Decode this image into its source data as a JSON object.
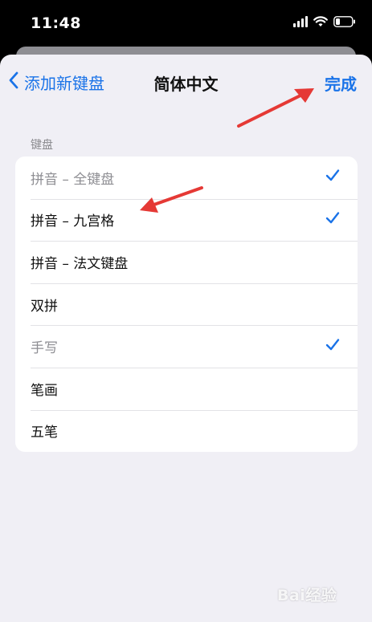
{
  "status_bar": {
    "time": "11:48"
  },
  "nav": {
    "back_label": "添加新键盘",
    "title": "简体中文",
    "done_label": "完成"
  },
  "section": {
    "header": "键盘"
  },
  "keyboards": [
    {
      "label": "拼音 – 全键盘",
      "checked": true,
      "dimmed": true
    },
    {
      "label": "拼音 – 九宫格",
      "checked": true,
      "dimmed": false
    },
    {
      "label": "拼音 – 法文键盘",
      "checked": false,
      "dimmed": false
    },
    {
      "label": "双拼",
      "checked": false,
      "dimmed": false
    },
    {
      "label": "手写",
      "checked": true,
      "dimmed": true
    },
    {
      "label": "笔画",
      "checked": false,
      "dimmed": false
    },
    {
      "label": "五笔",
      "checked": false,
      "dimmed": false
    }
  ],
  "icons": {
    "back": "chevron-left-icon",
    "check": "checkmark-icon",
    "signal": "signal-icon",
    "wifi": "wifi-icon",
    "battery": "battery-icon"
  },
  "colors": {
    "accent": "#1a73e8",
    "background": "#f0eff5",
    "annotation": "#e53935"
  },
  "watermark": {
    "text": "Bai经验"
  }
}
